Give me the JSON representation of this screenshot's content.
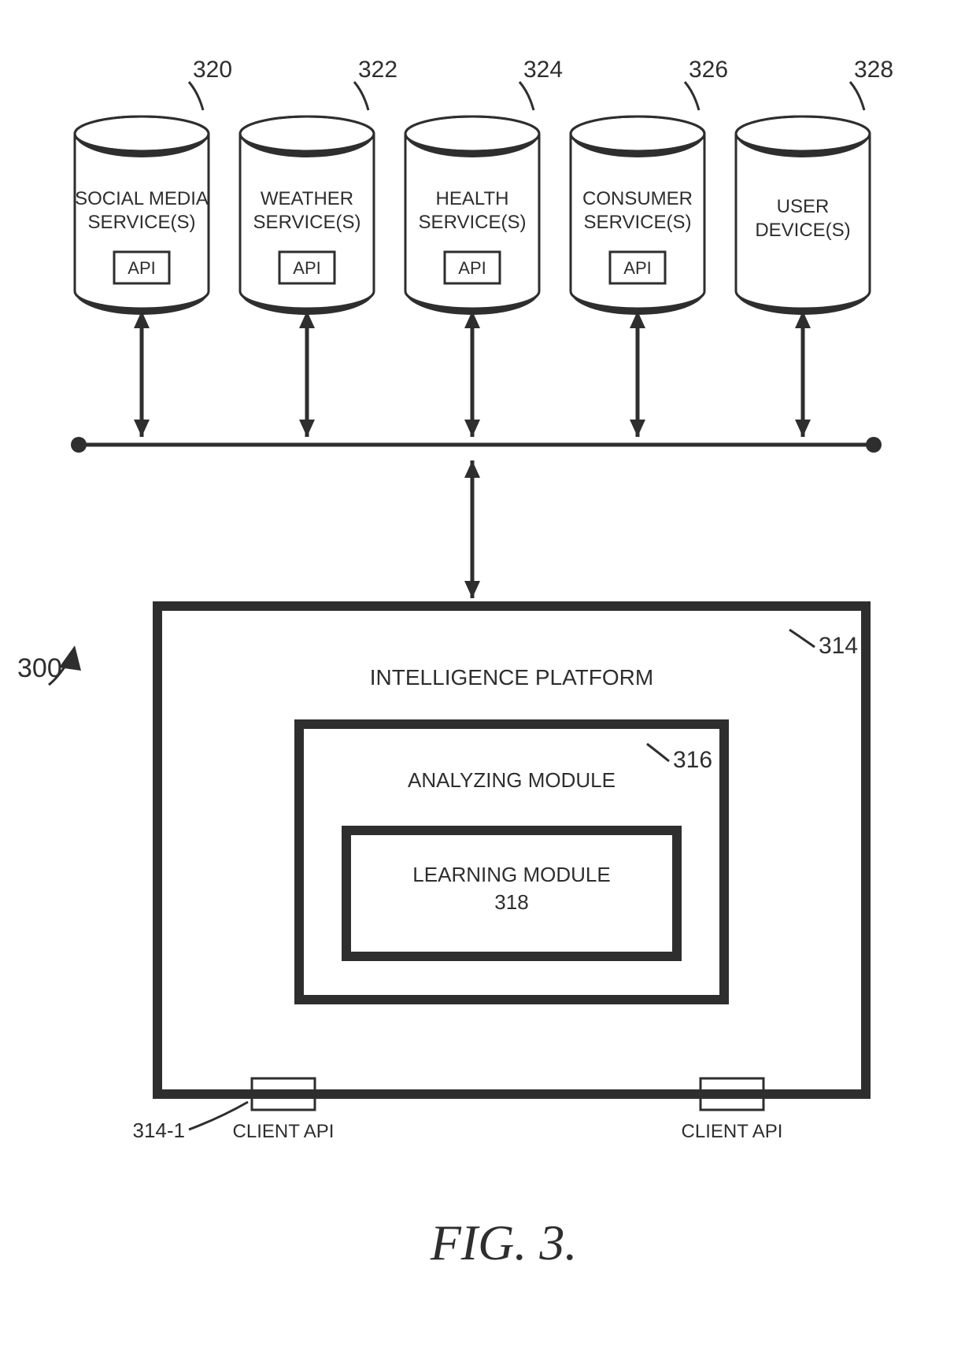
{
  "figure_ref": "300",
  "figure_caption": "FIG. 3.",
  "sources": [
    {
      "ref": "320",
      "label_line1": "SOCIAL MEDIA",
      "label_line2": "SERVICE(S)",
      "api": "API"
    },
    {
      "ref": "322",
      "label_line1": "WEATHER",
      "label_line2": "SERVICE(S)",
      "api": "API"
    },
    {
      "ref": "324",
      "label_line1": "HEALTH",
      "label_line2": "SERVICE(S)",
      "api": "API"
    },
    {
      "ref": "326",
      "label_line1": "CONSUMER",
      "label_line2": "SERVICE(S)",
      "api": "API"
    },
    {
      "ref": "328",
      "label_line1": "USER",
      "label_line2": "DEVICE(S)",
      "api": ""
    }
  ],
  "platform": {
    "ref": "314",
    "title": "INTELLIGENCE PLATFORM",
    "analyzing": {
      "ref": "316",
      "title": "ANALYZING MODULE"
    },
    "learning": {
      "ref": "318",
      "title": "LEARNING MODULE"
    },
    "client_api_label": "CLIENT API",
    "client_api_ref": "314-1"
  }
}
